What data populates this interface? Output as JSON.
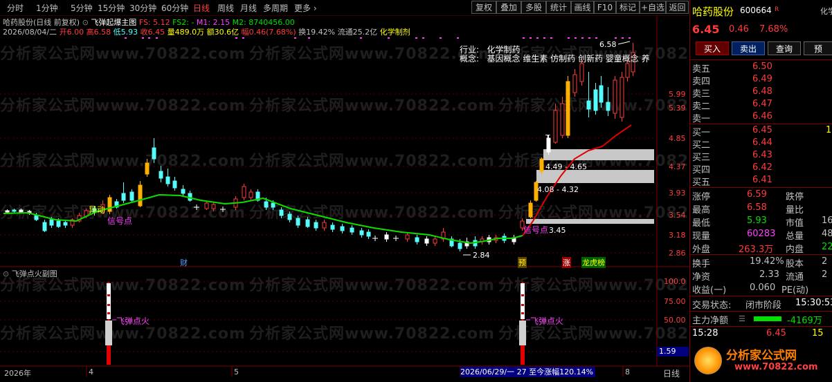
{
  "toolbar": {
    "periods": [
      "分时",
      "1分钟",
      "5分钟",
      "15分钟",
      "30分钟",
      "60分钟",
      "日线",
      "周线",
      "月线",
      "多周期",
      "更多"
    ],
    "active_period": "日线",
    "buttons": [
      "复权",
      "叠加",
      "多股",
      "统计",
      "画线",
      "F10",
      "标记",
      "+自选",
      "返回"
    ]
  },
  "chart_header": {
    "stock": "哈药股份(日线 前复权)",
    "indicator": "飞弹起爆主图",
    "fs_label": "FS: 5.12",
    "fs2_label": "FS2: -",
    "m1_label": "M1: 2.15",
    "m2_label": "M2: 8740456.00"
  },
  "info_line": {
    "date": "2026/08/04/二",
    "open": "开6.00",
    "high": "高6.58",
    "low": "低5.93",
    "close": "收6.45",
    "volume": "量489.0万",
    "amount": "额30.6亿",
    "change": "幅0.46(7.68%)",
    "turnover": "换19.42%",
    "float": "流通25.2亿",
    "concept": "化学制剂"
  },
  "industry_box": {
    "industry_label": "行业:",
    "industry_value": "化学制药",
    "concept_label": "概念:",
    "concept_value": "基因概念 维生素 仿制药 创新药 婴童概念 养"
  },
  "price_axis": [
    "5.99",
    "5.39",
    "4.85",
    "4.37",
    "3.93",
    "3.54",
    "3.18",
    "2.86"
  ],
  "annotations": {
    "max_price": "6.58",
    "min_price": "2.84",
    "low_right": "3.45",
    "zone1": "4.49 - 4.65",
    "zone2": "4.08 - 4.32",
    "t_mark": "T",
    "signal1": "异动",
    "signal2": "信号点",
    "signal3": "信号点",
    "badge_cai": "财",
    "badge_yu": "预",
    "badge_zhang": "涨",
    "badge_longhu": "龙虎榜"
  },
  "sub_chart": {
    "title": "飞弹点火副图",
    "label1": "飞弹点火",
    "label2": "飞弹点火",
    "axis": [
      "100.0",
      "75.00",
      "50.00",
      "1.59"
    ]
  },
  "bottom_axis": {
    "year": "2026年",
    "m4": "4",
    "m5": "5",
    "m8": "8",
    "range_text": "2026/06/29/一 27 至今涨幅120.14%",
    "period": "日线"
  },
  "watermark": "分析家公式网www.70822.com",
  "quote_panel": {
    "name": "哈药股份",
    "code": "600664",
    "tag": "R",
    "price": "6.45",
    "change": "0.46",
    "pct": "7.68%",
    "buttons": [
      "买入",
      "卖出",
      "查询"
    ],
    "sell": [
      {
        "label": "卖五",
        "price": "6.50"
      },
      {
        "label": "卖四",
        "price": "6.49"
      },
      {
        "label": "卖三",
        "price": "6.48"
      },
      {
        "label": "卖二",
        "price": "6.47"
      },
      {
        "label": "卖一",
        "price": "6.46"
      }
    ],
    "buy": [
      {
        "label": "买一",
        "price": "6.45",
        "vol": "1"
      },
      {
        "label": "买二",
        "price": "6.44"
      },
      {
        "label": "买三",
        "price": "6.43"
      },
      {
        "label": "买四",
        "price": "6.42"
      },
      {
        "label": "买五",
        "price": "6.41"
      }
    ],
    "stats": [
      {
        "k1": "涨停",
        "v1": "6.59",
        "k2": "跌停",
        "v2": ""
      },
      {
        "k1": "最高",
        "v1": "6.58",
        "k2": "量比",
        "v2": ""
      },
      {
        "k1": "最低",
        "v1": "5.93",
        "k2": "市值",
        "v2": "16"
      },
      {
        "k1": "现量",
        "v1": "60283",
        "k2": "总量",
        "v2": "48"
      },
      {
        "k1": "外盘",
        "v1": "263.3万",
        "k2": "内盘",
        "v2": "22"
      }
    ],
    "stats2": [
      {
        "k1": "换手",
        "v1": "19.42%",
        "k2": "股本",
        "v2": "2"
      },
      {
        "k1": "净资",
        "v1": "2.33",
        "k2": "流通",
        "v2": "2"
      },
      {
        "k1": "收益(一)",
        "v1": "0.060",
        "k2": "PE(动)",
        "v2": ""
      }
    ],
    "trade_status_label": "交易状态:",
    "trade_status": "闭市阶段",
    "trade_time": "15:30:53",
    "main_flow_label": "主力净额",
    "main_flow_value": "-4169万",
    "tick_time": "15:28",
    "tick_price": "6.45",
    "tick_vol": "15",
    "logo_text": "分析家公式网",
    "logo_url": "www.70822.com",
    "side_tab": "化学"
  }
}
